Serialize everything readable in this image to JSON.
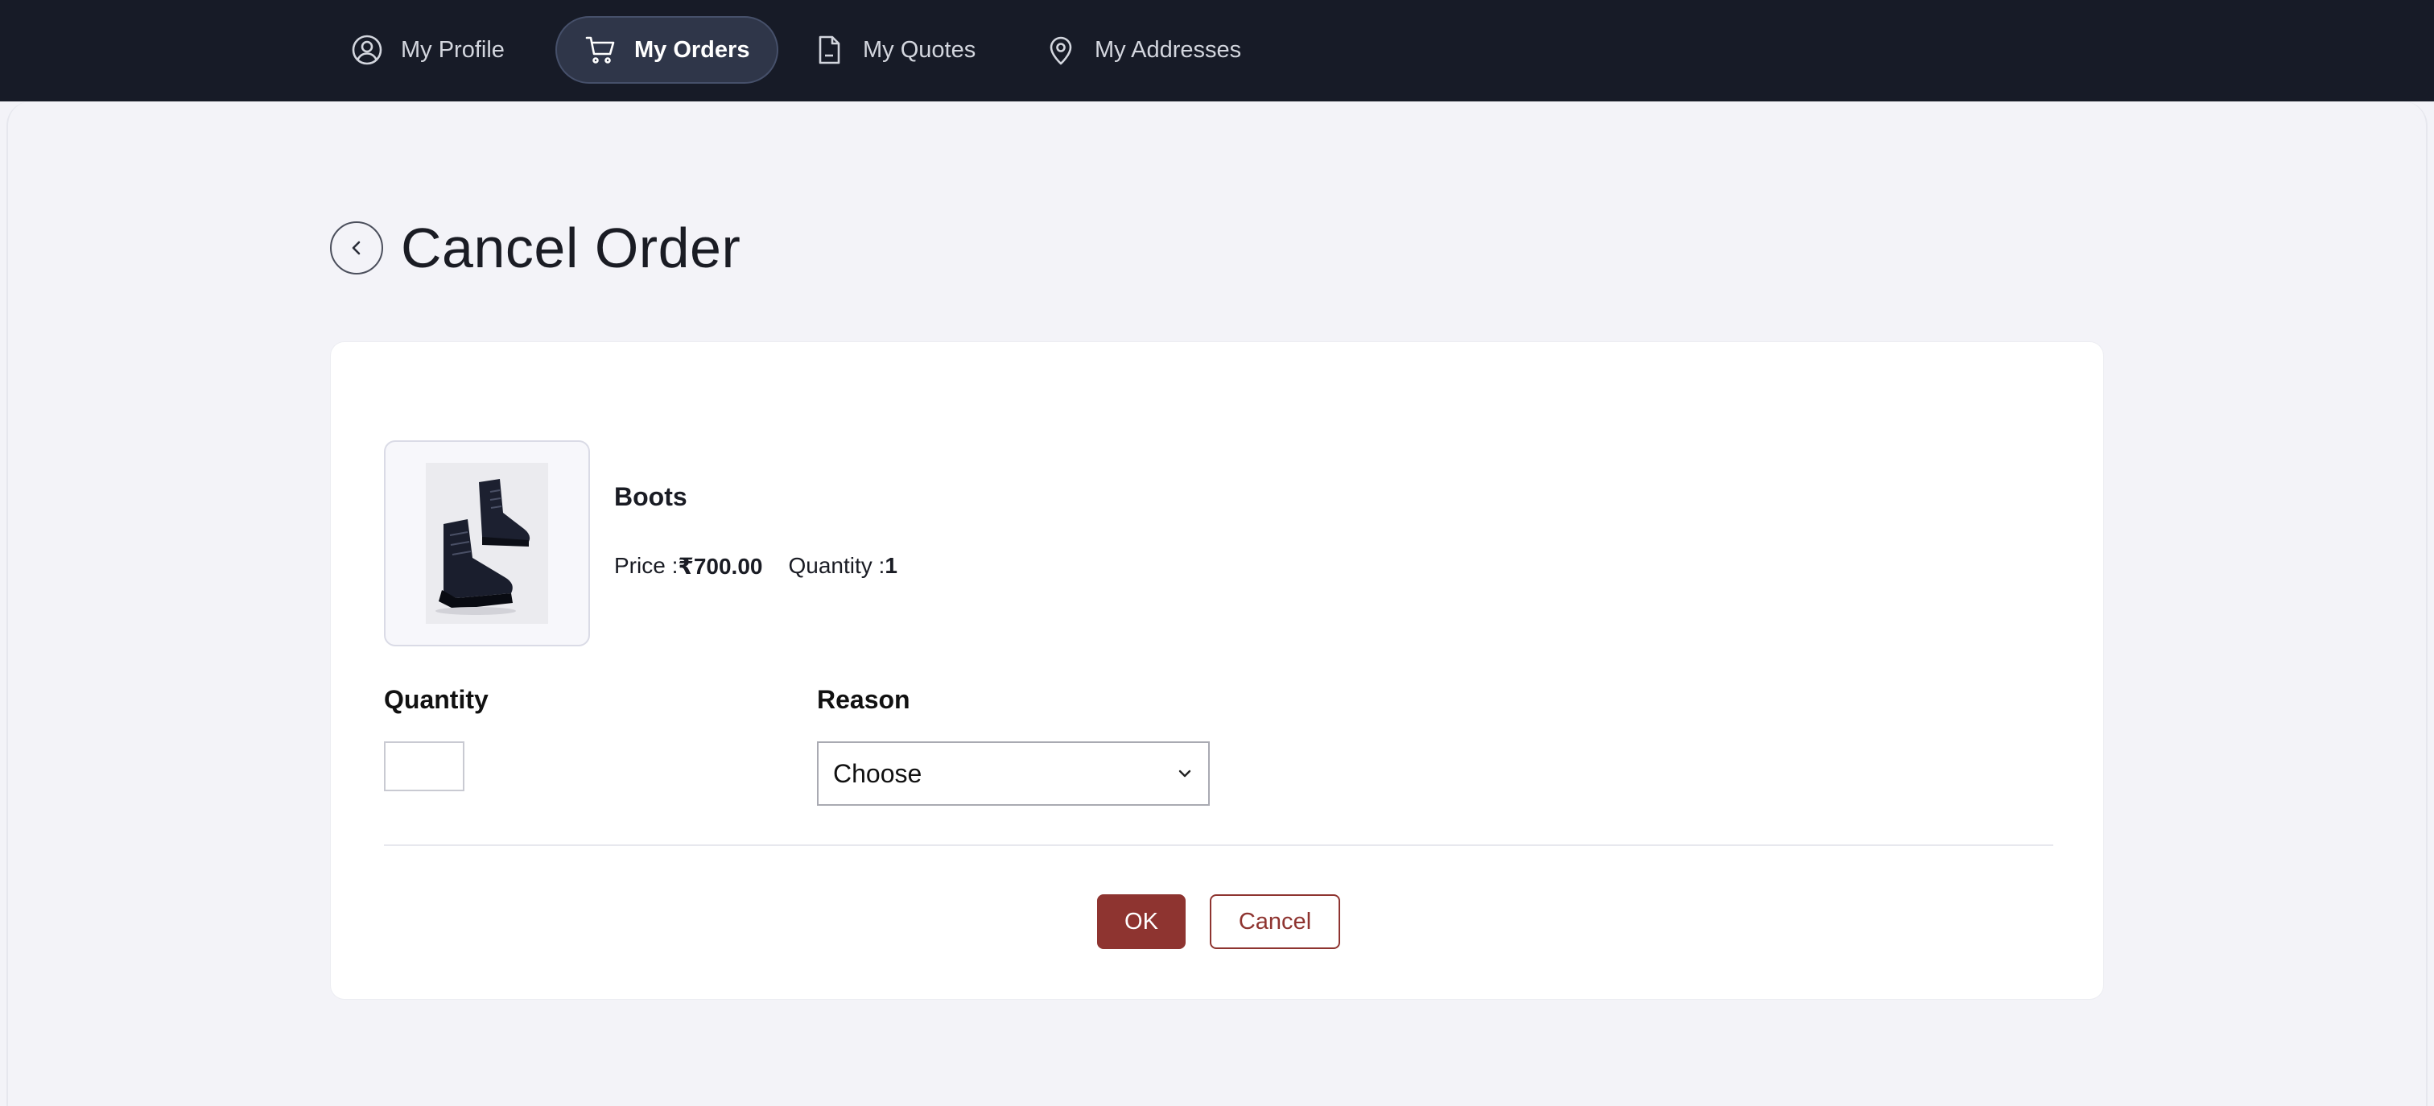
{
  "nav": {
    "items": [
      {
        "label": "My Profile",
        "icon": "user-circle-icon",
        "active": false
      },
      {
        "label": "My Orders",
        "icon": "cart-icon",
        "active": true
      },
      {
        "label": "My Quotes",
        "icon": "document-icon",
        "active": false
      },
      {
        "label": "My Addresses",
        "icon": "map-pin-icon",
        "active": false
      }
    ]
  },
  "page": {
    "title": "Cancel Order",
    "back_icon": "chevron-left-icon"
  },
  "product": {
    "name": "Boots",
    "price_label": "Price : ",
    "price": "₹700.00",
    "quantity_label": "Quantity : ",
    "quantity": "1",
    "image": "boots-image"
  },
  "form": {
    "quantity_label": "Quantity",
    "quantity_value": "",
    "reason_label": "Reason",
    "reason_selected": "Choose"
  },
  "actions": {
    "ok_label": "OK",
    "cancel_label": "Cancel"
  },
  "colors": {
    "nav_bg": "#171b27",
    "accent": "#8e3430",
    "page_bg": "#f3f3f8"
  }
}
